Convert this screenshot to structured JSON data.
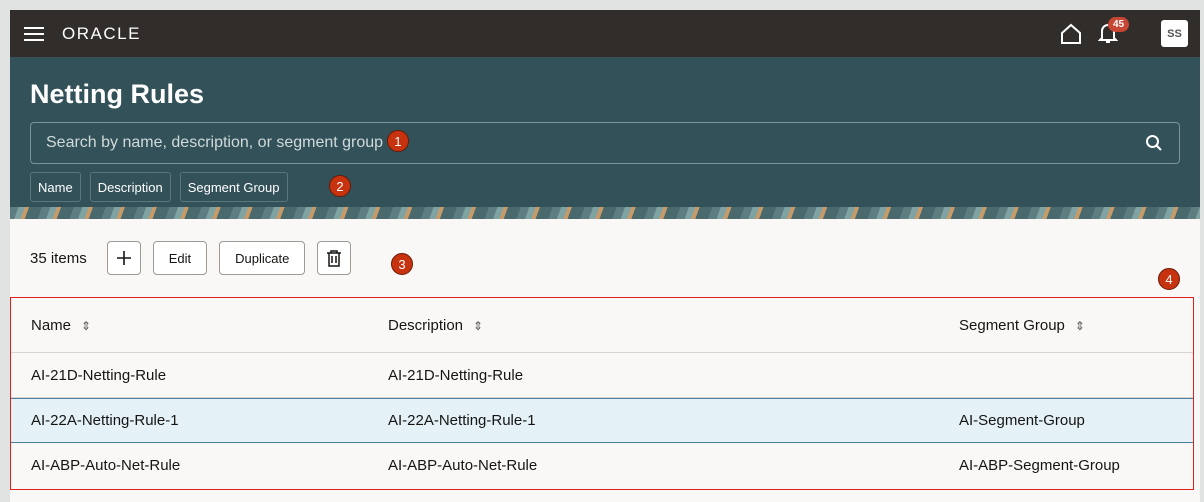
{
  "topbar": {
    "brand": "ORACLE",
    "notification_count": "45",
    "avatar_initials": "SS"
  },
  "header": {
    "title": "Netting Rules",
    "search_placeholder": "Search by name, description, or segment group",
    "filters": [
      "Name",
      "Description",
      "Segment Group"
    ]
  },
  "toolbar": {
    "count": "35 items",
    "edit": "Edit",
    "duplicate": "Duplicate"
  },
  "markers": [
    "1",
    "2",
    "3",
    "4"
  ],
  "table": {
    "columns": [
      "Name",
      "Description",
      "Segment Group"
    ],
    "rows": [
      {
        "name": "AI-21D-Netting-Rule",
        "description": "AI-21D-Netting-Rule",
        "segment_group": ""
      },
      {
        "name": "AI-22A-Netting-Rule-1",
        "description": "AI-22A-Netting-Rule-1",
        "segment_group": "AI-Segment-Group"
      },
      {
        "name": "AI-ABP-Auto-Net-Rule",
        "description": "AI-ABP-Auto-Net-Rule",
        "segment_group": "AI-ABP-Segment-Group"
      }
    ]
  }
}
